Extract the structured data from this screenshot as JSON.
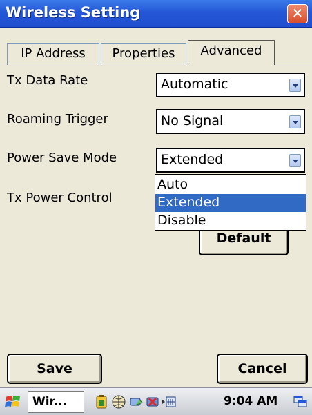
{
  "window": {
    "title": "Wireless Setting",
    "close_glyph": "✕"
  },
  "tabs": [
    {
      "label": "IP Address",
      "active": false
    },
    {
      "label": "Properties",
      "active": false
    },
    {
      "label": "Advanced",
      "active": true
    }
  ],
  "form": {
    "tx_data_rate": {
      "label": "Tx Data Rate",
      "value": "Automatic"
    },
    "roaming_trigger": {
      "label": "Roaming Trigger",
      "value": "No Signal"
    },
    "power_save_mode": {
      "label": "Power Save Mode",
      "value": "Extended",
      "options": [
        "Auto",
        "Extended",
        "Disable"
      ],
      "highlighted_option": "Extended"
    },
    "tx_power_control": {
      "label": "Tx Power Control"
    },
    "default_button": "Default"
  },
  "footer": {
    "save_label": "Save",
    "cancel_label": "Cancel"
  },
  "taskbar": {
    "task_label": "Wir...",
    "time": "9:04 AM"
  },
  "colors": {
    "title_bar": "#2457d6",
    "close_button": "#d54f2d",
    "selection": "#316ac5",
    "window_bg": "#ece9d8"
  }
}
